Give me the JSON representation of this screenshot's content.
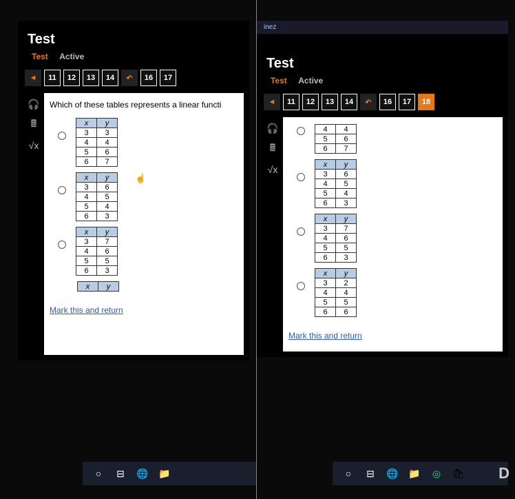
{
  "left": {
    "title": "Test",
    "tabs": {
      "test": "Test",
      "active": "Active"
    },
    "nav": [
      "◄",
      "11",
      "12",
      "13",
      "14",
      "↶",
      "16",
      "17"
    ],
    "question": "Which of these tables represents a linear functi",
    "table_headers": [
      "x",
      "y"
    ],
    "options": [
      {
        "rows": [
          [
            "3",
            "3"
          ],
          [
            "4",
            "4"
          ],
          [
            "5",
            "6"
          ],
          [
            "6",
            "7"
          ]
        ]
      },
      {
        "rows": [
          [
            "3",
            "6"
          ],
          [
            "4",
            "5"
          ],
          [
            "5",
            "4"
          ],
          [
            "6",
            "3"
          ]
        ]
      },
      {
        "rows": [
          [
            "3",
            "7"
          ],
          [
            "4",
            "6"
          ],
          [
            "5",
            "5"
          ],
          [
            "6",
            "3"
          ]
        ]
      },
      {
        "rows": []
      }
    ],
    "mark_link": "Mark this and return"
  },
  "right": {
    "username_fragment": "inez",
    "title": "Test",
    "tabs": {
      "test": "Test",
      "active": "Active"
    },
    "nav": [
      "◄",
      "11",
      "12",
      "13",
      "14",
      "↶",
      "16",
      "17",
      "18"
    ],
    "nav_active": "18",
    "table_headers": [
      "x",
      "y"
    ],
    "cont_table": {
      "rows": [
        [
          "4",
          "4"
        ],
        [
          "5",
          "6"
        ],
        [
          "6",
          "7"
        ]
      ]
    },
    "options": [
      {
        "rows": [
          [
            "3",
            "6"
          ],
          [
            "4",
            "5"
          ],
          [
            "5",
            "4"
          ],
          [
            "6",
            "3"
          ]
        ]
      },
      {
        "rows": [
          [
            "3",
            "7"
          ],
          [
            "4",
            "6"
          ],
          [
            "5",
            "5"
          ],
          [
            "6",
            "3"
          ]
        ]
      },
      {
        "rows": [
          [
            "3",
            "2"
          ],
          [
            "4",
            "4"
          ],
          [
            "5",
            "5"
          ],
          [
            "6",
            "6"
          ]
        ]
      }
    ],
    "mark_link": "Mark this and return"
  },
  "taskbar_icons": {
    "cortana": "○",
    "taskview": "⊟",
    "edge": "🌐",
    "explorer": "📁",
    "chrome": "◎",
    "store": "🛍"
  }
}
